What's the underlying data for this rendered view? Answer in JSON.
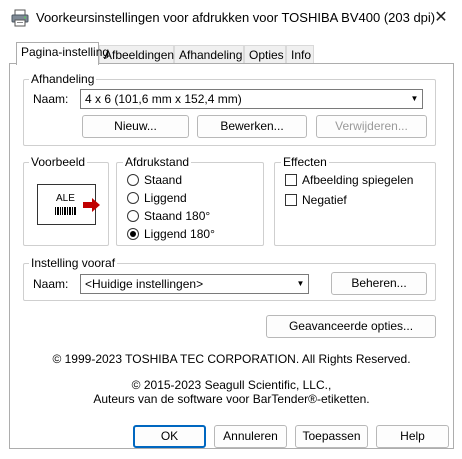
{
  "window": {
    "title": "Voorkeursinstellingen voor afdrukken voor TOSHIBA BV400 (203 dpi)",
    "close_glyph": "✕"
  },
  "tabs": [
    {
      "label": "Pagina-instelling",
      "active": true
    },
    {
      "label": "Afbeeldingen",
      "active": false
    },
    {
      "label": "Afhandeling",
      "active": false
    },
    {
      "label": "Opties",
      "active": false
    },
    {
      "label": "Info",
      "active": false
    }
  ],
  "afhandeling": {
    "legend": "Afhandeling",
    "name_label": "Naam:",
    "name_value": "4 x 6 (101,6 mm x 152,4 mm)",
    "new_button": "Nieuw...",
    "edit_button": "Bewerken...",
    "delete_button": "Verwijderen..."
  },
  "voorbeeld": {
    "legend": "Voorbeeld",
    "label_text": "ALE"
  },
  "afdrukstand": {
    "legend": "Afdrukstand",
    "options": [
      {
        "label": "Staand",
        "selected": false
      },
      {
        "label": "Liggend",
        "selected": false
      },
      {
        "label": "Staand 180°",
        "selected": false
      },
      {
        "label": "Liggend 180°",
        "selected": true
      }
    ]
  },
  "effecten": {
    "legend": "Effecten",
    "options": [
      {
        "label": "Afbeelding spiegelen",
        "checked": false
      },
      {
        "label": "Negatief",
        "checked": false
      }
    ]
  },
  "instelling_vooraf": {
    "legend": "Instelling vooraf",
    "name_label": "Naam:",
    "name_value": "<Huidige instellingen>",
    "manage_button": "Beheren..."
  },
  "advanced_button": "Geavanceerde opties...",
  "copyright": {
    "line1": "© 1999-2023 TOSHIBA TEC CORPORATION.  All Rights Reserved.",
    "line2": "© 2015-2023 Seagull Scientific, LLC.,",
    "line3": "Auteurs van de software voor BarTender®-etiketten."
  },
  "footer": {
    "ok": "OK",
    "cancel": "Annuleren",
    "apply": "Toepassen",
    "help": "Help"
  },
  "colors": {
    "accent": "#0067c0",
    "preview_arrow": "#c00000"
  }
}
